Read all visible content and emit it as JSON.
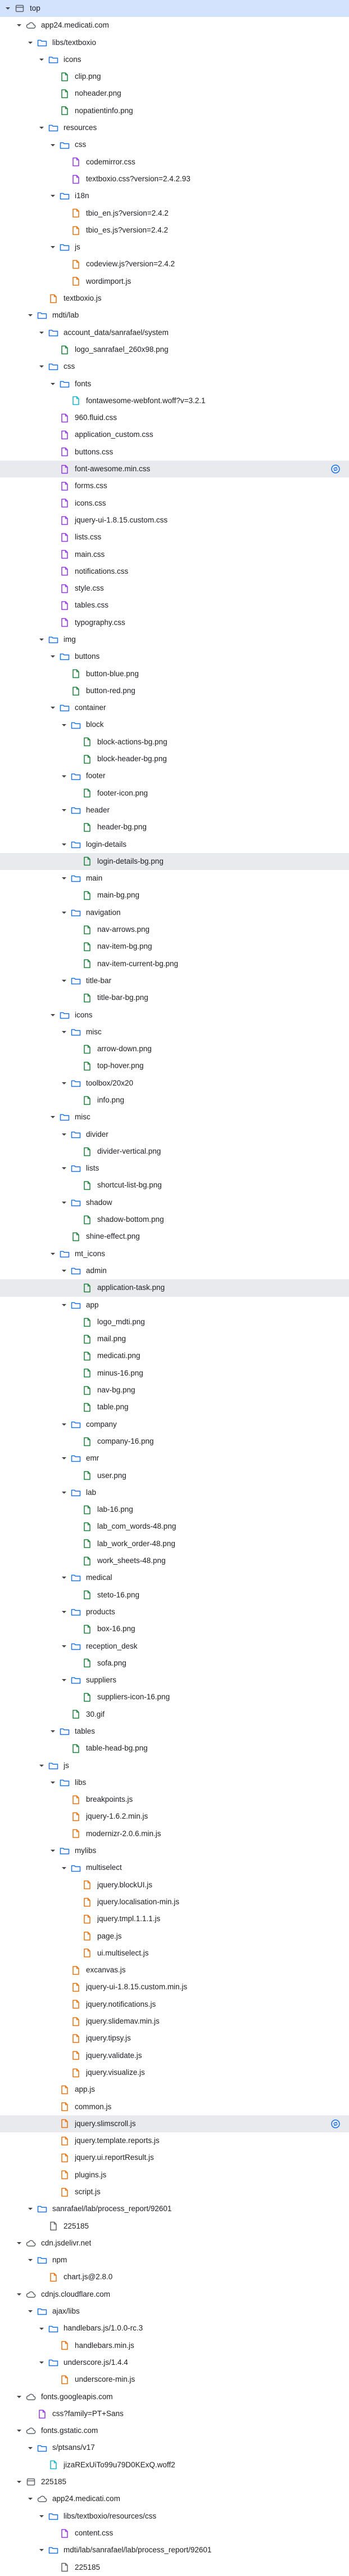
{
  "tree": [
    {
      "d": 0,
      "k": "frame",
      "label": "top",
      "open": true,
      "sel": true
    },
    {
      "d": 1,
      "k": "cloud",
      "label": "app24.medicati.com",
      "open": true
    },
    {
      "d": 2,
      "k": "folder",
      "label": "libs/textboxio",
      "open": true
    },
    {
      "d": 3,
      "k": "folder",
      "label": "icons",
      "open": true
    },
    {
      "d": 4,
      "k": "img",
      "label": "clip.png"
    },
    {
      "d": 4,
      "k": "img",
      "label": "noheader.png"
    },
    {
      "d": 4,
      "k": "img",
      "label": "nopatientinfo.png"
    },
    {
      "d": 3,
      "k": "folder",
      "label": "resources",
      "open": true
    },
    {
      "d": 4,
      "k": "folder",
      "label": "css",
      "open": true
    },
    {
      "d": 5,
      "k": "css",
      "label": "codemirror.css"
    },
    {
      "d": 5,
      "k": "css",
      "label": "textboxio.css?version=2.4.2.93"
    },
    {
      "d": 4,
      "k": "folder",
      "label": "i18n",
      "open": true
    },
    {
      "d": 5,
      "k": "js",
      "label": "tbio_en.js?version=2.4.2"
    },
    {
      "d": 5,
      "k": "js",
      "label": "tbio_es.js?version=2.4.2"
    },
    {
      "d": 4,
      "k": "folder",
      "label": "js",
      "open": true
    },
    {
      "d": 5,
      "k": "js",
      "label": "codeview.js?version=2.4.2"
    },
    {
      "d": 5,
      "k": "js",
      "label": "wordimport.js"
    },
    {
      "d": 3,
      "k": "js",
      "label": "textboxio.js"
    },
    {
      "d": 2,
      "k": "folder",
      "label": "mdti/lab",
      "open": true
    },
    {
      "d": 3,
      "k": "folder",
      "label": "account_data/sanrafael/system",
      "open": true
    },
    {
      "d": 4,
      "k": "img",
      "label": "logo_sanrafael_260x98.png"
    },
    {
      "d": 3,
      "k": "folder",
      "label": "css",
      "open": true
    },
    {
      "d": 4,
      "k": "folder",
      "label": "fonts",
      "open": true
    },
    {
      "d": 5,
      "k": "font",
      "label": "fontawesome-webfont.woff?v=3.2.1"
    },
    {
      "d": 4,
      "k": "css",
      "label": "960.fluid.css"
    },
    {
      "d": 4,
      "k": "css",
      "label": "application_custom.css"
    },
    {
      "d": 4,
      "k": "css",
      "label": "buttons.css"
    },
    {
      "d": 4,
      "k": "css",
      "label": "font-awesome.min.css",
      "hl": true,
      "badge": true
    },
    {
      "d": 4,
      "k": "css",
      "label": "forms.css"
    },
    {
      "d": 4,
      "k": "css",
      "label": "icons.css"
    },
    {
      "d": 4,
      "k": "css",
      "label": "jquery-ui-1.8.15.custom.css"
    },
    {
      "d": 4,
      "k": "css",
      "label": "lists.css"
    },
    {
      "d": 4,
      "k": "css",
      "label": "main.css"
    },
    {
      "d": 4,
      "k": "css",
      "label": "notifications.css"
    },
    {
      "d": 4,
      "k": "css",
      "label": "style.css"
    },
    {
      "d": 4,
      "k": "css",
      "label": "tables.css"
    },
    {
      "d": 4,
      "k": "css",
      "label": "typography.css"
    },
    {
      "d": 3,
      "k": "folder",
      "label": "img",
      "open": true
    },
    {
      "d": 4,
      "k": "folder",
      "label": "buttons",
      "open": true
    },
    {
      "d": 5,
      "k": "img",
      "label": "button-blue.png"
    },
    {
      "d": 5,
      "k": "img",
      "label": "button-red.png"
    },
    {
      "d": 4,
      "k": "folder",
      "label": "container",
      "open": true
    },
    {
      "d": 5,
      "k": "folder",
      "label": "block",
      "open": true
    },
    {
      "d": 6,
      "k": "img",
      "label": "block-actions-bg.png"
    },
    {
      "d": 6,
      "k": "img",
      "label": "block-header-bg.png"
    },
    {
      "d": 5,
      "k": "folder",
      "label": "footer",
      "open": true
    },
    {
      "d": 6,
      "k": "img",
      "label": "footer-icon.png"
    },
    {
      "d": 5,
      "k": "folder",
      "label": "header",
      "open": true
    },
    {
      "d": 6,
      "k": "img",
      "label": "header-bg.png"
    },
    {
      "d": 5,
      "k": "folder",
      "label": "login-details",
      "open": true
    },
    {
      "d": 6,
      "k": "img",
      "label": "login-details-bg.png",
      "hl": true
    },
    {
      "d": 5,
      "k": "folder",
      "label": "main",
      "open": true
    },
    {
      "d": 6,
      "k": "img",
      "label": "main-bg.png"
    },
    {
      "d": 5,
      "k": "folder",
      "label": "navigation",
      "open": true
    },
    {
      "d": 6,
      "k": "img",
      "label": "nav-arrows.png"
    },
    {
      "d": 6,
      "k": "img",
      "label": "nav-item-bg.png"
    },
    {
      "d": 6,
      "k": "img",
      "label": "nav-item-current-bg.png"
    },
    {
      "d": 5,
      "k": "folder",
      "label": "title-bar",
      "open": true
    },
    {
      "d": 6,
      "k": "img",
      "label": "title-bar-bg.png"
    },
    {
      "d": 4,
      "k": "folder",
      "label": "icons",
      "open": true
    },
    {
      "d": 5,
      "k": "folder",
      "label": "misc",
      "open": true
    },
    {
      "d": 6,
      "k": "img",
      "label": "arrow-down.png"
    },
    {
      "d": 6,
      "k": "img",
      "label": "top-hover.png"
    },
    {
      "d": 5,
      "k": "folder",
      "label": "toolbox/20x20",
      "open": true
    },
    {
      "d": 6,
      "k": "img",
      "label": "info.png"
    },
    {
      "d": 4,
      "k": "folder",
      "label": "misc",
      "open": true
    },
    {
      "d": 5,
      "k": "folder",
      "label": "divider",
      "open": true
    },
    {
      "d": 6,
      "k": "img",
      "label": "divider-vertical.png"
    },
    {
      "d": 5,
      "k": "folder",
      "label": "lists",
      "open": true
    },
    {
      "d": 6,
      "k": "img",
      "label": "shortcut-list-bg.png"
    },
    {
      "d": 5,
      "k": "folder",
      "label": "shadow",
      "open": true
    },
    {
      "d": 6,
      "k": "img",
      "label": "shadow-bottom.png"
    },
    {
      "d": 5,
      "k": "img",
      "label": "shine-effect.png"
    },
    {
      "d": 4,
      "k": "folder",
      "label": "mt_icons",
      "open": true
    },
    {
      "d": 5,
      "k": "folder",
      "label": "admin",
      "open": true
    },
    {
      "d": 6,
      "k": "img",
      "label": "application-task.png",
      "hl": true
    },
    {
      "d": 5,
      "k": "folder",
      "label": "app",
      "open": true
    },
    {
      "d": 6,
      "k": "img",
      "label": "logo_mdti.png"
    },
    {
      "d": 6,
      "k": "img",
      "label": "mail.png"
    },
    {
      "d": 6,
      "k": "img",
      "label": "medicati.png"
    },
    {
      "d": 6,
      "k": "img",
      "label": "minus-16.png"
    },
    {
      "d": 6,
      "k": "img",
      "label": "nav-bg.png"
    },
    {
      "d": 6,
      "k": "img",
      "label": "table.png"
    },
    {
      "d": 5,
      "k": "folder",
      "label": "company",
      "open": true
    },
    {
      "d": 6,
      "k": "img",
      "label": "company-16.png"
    },
    {
      "d": 5,
      "k": "folder",
      "label": "emr",
      "open": true
    },
    {
      "d": 6,
      "k": "img",
      "label": "user.png"
    },
    {
      "d": 5,
      "k": "folder",
      "label": "lab",
      "open": true
    },
    {
      "d": 6,
      "k": "img",
      "label": "lab-16.png"
    },
    {
      "d": 6,
      "k": "img",
      "label": "lab_com_words-48.png"
    },
    {
      "d": 6,
      "k": "img",
      "label": "lab_work_order-48.png"
    },
    {
      "d": 6,
      "k": "img",
      "label": "work_sheets-48.png"
    },
    {
      "d": 5,
      "k": "folder",
      "label": "medical",
      "open": true
    },
    {
      "d": 6,
      "k": "img",
      "label": "steto-16.png"
    },
    {
      "d": 5,
      "k": "folder",
      "label": "products",
      "open": true
    },
    {
      "d": 6,
      "k": "img",
      "label": "box-16.png"
    },
    {
      "d": 5,
      "k": "folder",
      "label": "reception_desk",
      "open": true
    },
    {
      "d": 6,
      "k": "img",
      "label": "sofa.png"
    },
    {
      "d": 5,
      "k": "folder",
      "label": "suppliers",
      "open": true
    },
    {
      "d": 6,
      "k": "img",
      "label": "suppliers-icon-16.png"
    },
    {
      "d": 5,
      "k": "img",
      "label": "30.gif"
    },
    {
      "d": 4,
      "k": "folder",
      "label": "tables",
      "open": true
    },
    {
      "d": 5,
      "k": "img",
      "label": "table-head-bg.png"
    },
    {
      "d": 3,
      "k": "folder",
      "label": "js",
      "open": true
    },
    {
      "d": 4,
      "k": "folder",
      "label": "libs",
      "open": true
    },
    {
      "d": 5,
      "k": "js",
      "label": "breakpoints.js"
    },
    {
      "d": 5,
      "k": "js",
      "label": "jquery-1.6.2.min.js"
    },
    {
      "d": 5,
      "k": "js",
      "label": "modernizr-2.0.6.min.js"
    },
    {
      "d": 4,
      "k": "folder",
      "label": "mylibs",
      "open": true
    },
    {
      "d": 5,
      "k": "folder",
      "label": "multiselect",
      "open": true
    },
    {
      "d": 6,
      "k": "js",
      "label": "jquery.blockUI.js"
    },
    {
      "d": 6,
      "k": "js",
      "label": "jquery.localisation-min.js"
    },
    {
      "d": 6,
      "k": "js",
      "label": "jquery.tmpl.1.1.1.js"
    },
    {
      "d": 6,
      "k": "js",
      "label": "page.js"
    },
    {
      "d": 6,
      "k": "js",
      "label": "ui.multiselect.js"
    },
    {
      "d": 5,
      "k": "js",
      "label": "excanvas.js"
    },
    {
      "d": 5,
      "k": "js",
      "label": "jquery-ui-1.8.15.custom.min.js"
    },
    {
      "d": 5,
      "k": "js",
      "label": "jquery.notifications.js"
    },
    {
      "d": 5,
      "k": "js",
      "label": "jquery.slidemav.min.js"
    },
    {
      "d": 5,
      "k": "js",
      "label": "jquery.tipsy.js"
    },
    {
      "d": 5,
      "k": "js",
      "label": "jquery.validate.js"
    },
    {
      "d": 5,
      "k": "js",
      "label": "jquery.visualize.js"
    },
    {
      "d": 4,
      "k": "js",
      "label": "app.js"
    },
    {
      "d": 4,
      "k": "js",
      "label": "common.js"
    },
    {
      "d": 4,
      "k": "js",
      "label": "jquery.slimscroll.js",
      "hl": true,
      "badge": true
    },
    {
      "d": 4,
      "k": "js",
      "label": "jquery.template.reports.js"
    },
    {
      "d": 4,
      "k": "js",
      "label": "jquery.ui.reportResult.js"
    },
    {
      "d": 4,
      "k": "js",
      "label": "plugins.js"
    },
    {
      "d": 4,
      "k": "js",
      "label": "script.js"
    },
    {
      "d": 2,
      "k": "folder",
      "label": "sanrafael/lab/process_report/92601",
      "open": true
    },
    {
      "d": 3,
      "k": "doc",
      "label": "225185"
    },
    {
      "d": 1,
      "k": "cloud",
      "label": "cdn.jsdelivr.net",
      "open": true
    },
    {
      "d": 2,
      "k": "folder",
      "label": "npm",
      "open": true
    },
    {
      "d": 3,
      "k": "js",
      "label": "chart.js@2.8.0"
    },
    {
      "d": 1,
      "k": "cloud",
      "label": "cdnjs.cloudflare.com",
      "open": true
    },
    {
      "d": 2,
      "k": "folder",
      "label": "ajax/libs",
      "open": true
    },
    {
      "d": 3,
      "k": "folder",
      "label": "handlebars.js/1.0.0-rc.3",
      "open": true
    },
    {
      "d": 4,
      "k": "js",
      "label": "handlebars.min.js"
    },
    {
      "d": 3,
      "k": "folder",
      "label": "underscore.js/1.4.4",
      "open": true
    },
    {
      "d": 4,
      "k": "js",
      "label": "underscore-min.js"
    },
    {
      "d": 1,
      "k": "cloud",
      "label": "fonts.googleapis.com",
      "open": true
    },
    {
      "d": 2,
      "k": "css",
      "label": "css?family=PT+Sans"
    },
    {
      "d": 1,
      "k": "cloud",
      "label": "fonts.gstatic.com",
      "open": true
    },
    {
      "d": 2,
      "k": "folder",
      "label": "s/ptsans/v17",
      "open": true
    },
    {
      "d": 3,
      "k": "font",
      "label": "jizaRExUiTo99u79D0KExQ.woff2"
    },
    {
      "d": 1,
      "k": "frame",
      "label": "225185",
      "open": true
    },
    {
      "d": 2,
      "k": "cloud",
      "label": "app24.medicati.com",
      "open": true
    },
    {
      "d": 3,
      "k": "folder",
      "label": "libs/textboxio/resources/css",
      "open": true
    },
    {
      "d": 4,
      "k": "css",
      "label": "content.css"
    },
    {
      "d": 3,
      "k": "folder",
      "label": "mdti/lab/sanrafael/lab/process_report/92601",
      "open": true
    },
    {
      "d": 4,
      "k": "doc",
      "label": "225185"
    }
  ],
  "icon_names": {
    "frame": "frame-icon",
    "cloud": "cloud-icon",
    "folder": "folder-icon",
    "img": "image-file-icon",
    "css": "css-file-icon",
    "js": "js-file-icon",
    "font": "font-file-icon",
    "doc": "document-icon"
  },
  "colors": {
    "folder": "#1a73e8",
    "image": "#188038",
    "script": "#e8710a",
    "stylesheet": "#9334e6",
    "font": "#12b5cb",
    "document": "#5f6368",
    "selected_row": "#d3e3fd",
    "highlighted_row": "#e8eaed",
    "badge": "#1a73e8"
  }
}
